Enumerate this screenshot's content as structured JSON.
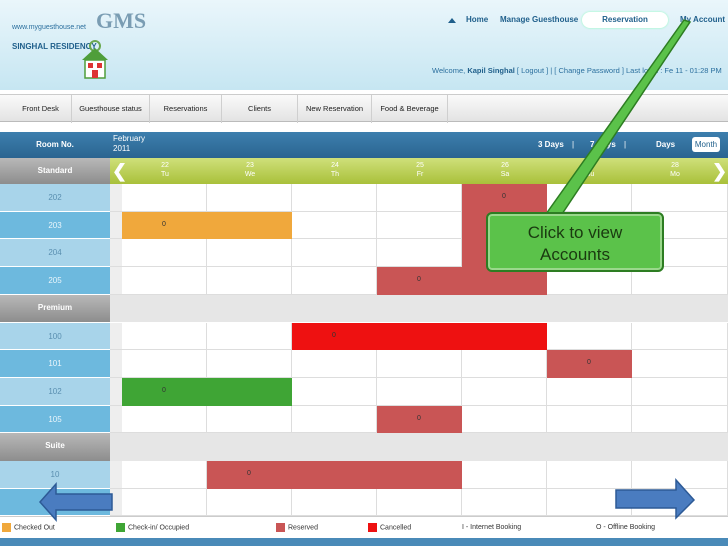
{
  "header": {
    "url": "www.myguesthouse.net",
    "brand": "GMS",
    "property": "SINGHAL RESIDENCY",
    "nav": [
      "Home",
      "Manage Guesthouse",
      "Reservation",
      "My Account"
    ],
    "welcome_prefix": "Welcome,",
    "user": "Kapil Singhal",
    "links": "[ Logout ]  |  [ Change Password ]  Last login : Fe",
    "last_login_tail": "11 - 01:28 PM"
  },
  "menu": [
    "Front Desk",
    "Guesthouse status",
    "Reservations",
    "Clients",
    "New Reservation",
    "Food & Beverage"
  ],
  "grid": {
    "room_header": "Room No.",
    "month": "February",
    "year": "2011",
    "view_options": [
      "3 Days",
      "|",
      "7 Days",
      "|",
      "Days"
    ],
    "view_selected": "Month",
    "dates": [
      {
        "d": "22",
        "w": "Tu"
      },
      {
        "d": "23",
        "w": "We"
      },
      {
        "d": "24",
        "w": "Th"
      },
      {
        "d": "25",
        "w": "Fr"
      },
      {
        "d": "26",
        "w": "Sa"
      },
      {
        "d": "27",
        "w": "Su"
      },
      {
        "d": "28",
        "w": "Mo"
      }
    ],
    "left_arrow": "❮",
    "right_arrow": "❯"
  },
  "rows": [
    {
      "type": "cat",
      "label": "Standard"
    },
    {
      "type": "room",
      "label": "202",
      "bookings": [
        {
          "start": 4,
          "span": 1,
          "status": "reserved",
          "text": "0"
        }
      ]
    },
    {
      "type": "room",
      "label": "203",
      "bookings": [
        {
          "start": 0,
          "span": 2,
          "status": "checked_out",
          "text": "0"
        },
        {
          "start": 4,
          "span": 1,
          "status": "reserved",
          "text": ""
        }
      ]
    },
    {
      "type": "room",
      "label": "204",
      "bookings": [
        {
          "start": 4,
          "span": 1,
          "status": "reserved",
          "text": ""
        }
      ]
    },
    {
      "type": "room",
      "label": "205",
      "bookings": [
        {
          "start": 3,
          "span": 2,
          "status": "reserved",
          "text": "0"
        }
      ]
    },
    {
      "type": "cat",
      "label": "Premium"
    },
    {
      "type": "room",
      "label": "100",
      "bookings": [
        {
          "start": 2,
          "span": 3,
          "status": "cancelled",
          "text": "0"
        }
      ]
    },
    {
      "type": "room",
      "label": "101",
      "bookings": [
        {
          "start": 5,
          "span": 1,
          "status": "reserved",
          "text": "0"
        }
      ]
    },
    {
      "type": "room",
      "label": "102",
      "bookings": [
        {
          "start": 0,
          "span": 2,
          "status": "checked_in",
          "text": "0"
        }
      ]
    },
    {
      "type": "room",
      "label": "105",
      "bookings": [
        {
          "start": 3,
          "span": 1,
          "status": "reserved",
          "text": "0"
        }
      ]
    },
    {
      "type": "cat",
      "label": "Suite"
    },
    {
      "type": "room",
      "label": "10",
      "bookings": [
        {
          "start": 1,
          "span": 3,
          "status": "reserved",
          "text": "0"
        }
      ]
    },
    {
      "type": "room",
      "label": "",
      "bookings": []
    }
  ],
  "legend": [
    {
      "label": "Checked Out",
      "color": "#f0a83c"
    },
    {
      "label": "Check-in/ Occupied",
      "color": "#3fa535"
    },
    {
      "label": "Reserved",
      "color": "#c95555"
    },
    {
      "label": "Cancelled",
      "color": "#ee1111"
    },
    {
      "label": "I - Internet Booking",
      "color": ""
    },
    {
      "label": "O - Offline Booking",
      "color": ""
    }
  ],
  "colors": {
    "checked_out": "#f0a83c",
    "checked_in": "#3fa535",
    "reserved": "#c95555",
    "cancelled": "#ee1111"
  },
  "callout": {
    "line1": "Click to view",
    "line2": "Accounts"
  }
}
